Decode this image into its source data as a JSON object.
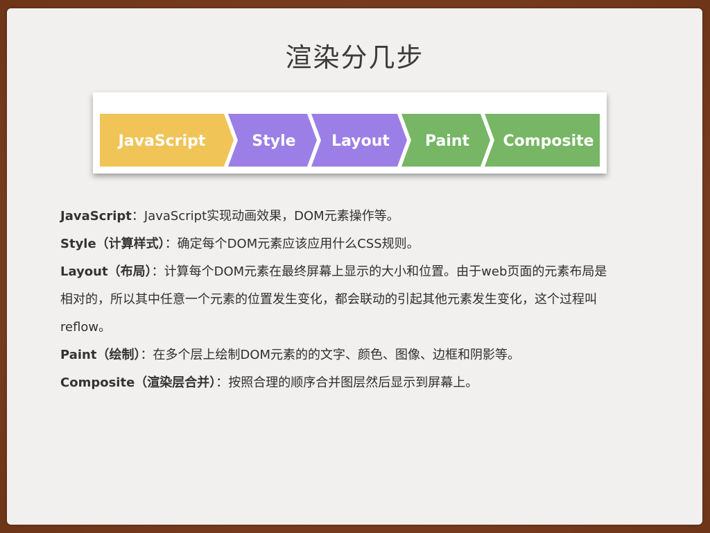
{
  "slide": {
    "title": "渲染分几步"
  },
  "pipeline": {
    "steps": [
      {
        "label": "JavaScript",
        "color": "#f0c457"
      },
      {
        "label": "Style",
        "color": "#9b7fe6"
      },
      {
        "label": "Layout",
        "color": "#9b7fe6"
      },
      {
        "label": "Paint",
        "color": "#76b665"
      },
      {
        "label": "Composite",
        "color": "#76b665"
      }
    ]
  },
  "content": {
    "lines": [
      {
        "term": "JavaScript",
        "text": "：JavaScript实现动画效果，DOM元素操作等。"
      },
      {
        "term": "Style（计算样式）",
        "text": "：确定每个DOM元素应该应用什么CSS规则。"
      },
      {
        "term": "Layout（布局）",
        "text": "：计算每个DOM元素在最终屏幕上显示的大小和位置。由于web页面的元素布局是"
      },
      {
        "term": "",
        "text": "相对的，所以其中任意一个元素的位置发生变化，都会联动的引起其他元素发生变化，这个过程叫"
      },
      {
        "term": "",
        "text": "reflow。"
      },
      {
        "term": "Paint（绘制）",
        "text": "：在多个层上绘制DOM元素的的文字、颜色、图像、边框和阴影等。"
      },
      {
        "term": "Composite（渲染层合并）",
        "text": "：按照合理的顺序合并图层然后显示到屏幕上。"
      }
    ]
  }
}
